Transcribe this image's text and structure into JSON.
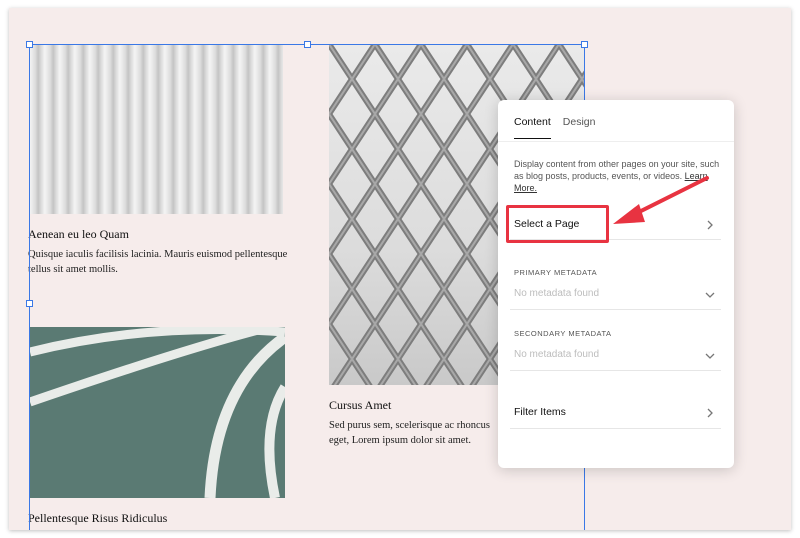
{
  "canvas": {
    "items": [
      {
        "title": "Aenean eu leo Quam",
        "body": "Quisque iaculis facilisis lacinia. Mauris euismod pellentesque tellus sit amet mollis."
      },
      {
        "title": "Cursus Amet",
        "body": "Sed purus sem, scelerisque ac rhoncus eget, Lorem ipsum dolor sit amet."
      },
      {
        "title": "Pellentesque Risus Ridiculus",
        "body": ""
      }
    ]
  },
  "panel": {
    "tabs": [
      {
        "label": "Content",
        "active": true
      },
      {
        "label": "Design",
        "active": false
      }
    ],
    "description": "Display content from other pages on your site, such as blog posts, products, events, or videos.",
    "learn_more": "Learn More.",
    "select_page": "Select a Page",
    "primary_metadata": {
      "label": "PRIMARY METADATA",
      "value": "No metadata found"
    },
    "secondary_metadata": {
      "label": "SECONDARY METADATA",
      "value": "No metadata found"
    },
    "filter_items": "Filter Items"
  },
  "colors": {
    "canvas_background": "#f6eceb",
    "selection_blue": "#3a78e6",
    "annotation_red": "#e83341"
  }
}
